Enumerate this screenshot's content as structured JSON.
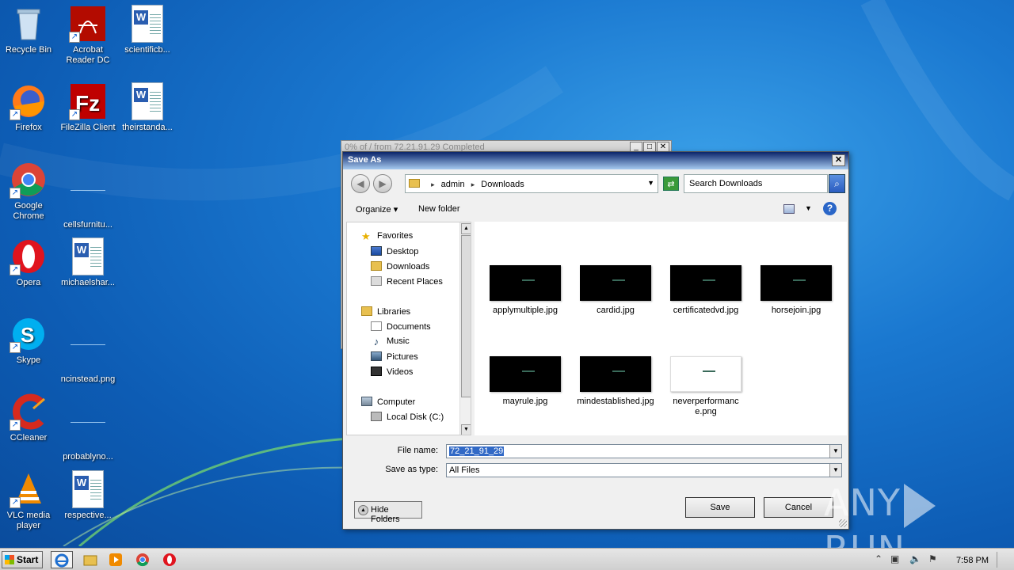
{
  "desktop": {
    "icons": [
      {
        "label": "Recycle Bin",
        "icon": "recycle-bin-icon"
      },
      {
        "label": "Acrobat Reader DC",
        "icon": "acrobat-icon"
      },
      {
        "label": "scientificb...",
        "icon": "word-doc-icon"
      },
      {
        "label": "Firefox",
        "icon": "firefox-icon"
      },
      {
        "label": "FileZilla Client",
        "icon": "filezilla-icon"
      },
      {
        "label": "theirstanda...",
        "icon": "word-doc-icon"
      },
      {
        "label": "Google Chrome",
        "icon": "chrome-icon"
      },
      {
        "label": "cellsfurnitu...",
        "icon": "file-icon"
      },
      {
        "label": "Opera",
        "icon": "opera-icon"
      },
      {
        "label": "michaelshar...",
        "icon": "word-doc-icon"
      },
      {
        "label": "Skype",
        "icon": "skype-icon"
      },
      {
        "label": "ncinstead.png",
        "icon": "file-icon"
      },
      {
        "label": "CCleaner",
        "icon": "ccleaner-icon"
      },
      {
        "label": "probablyno...",
        "icon": "file-icon"
      },
      {
        "label": "VLC media player",
        "icon": "vlc-icon"
      },
      {
        "label": "respective...",
        "icon": "word-doc-icon"
      }
    ]
  },
  "bg_window": {
    "title": "0% of / from 72.21.91.29 Completed"
  },
  "dialog": {
    "title": "Save As",
    "close": "✕",
    "address": {
      "root": "admin",
      "folder": "Downloads"
    },
    "search_placeholder": "Search Downloads",
    "toolbar": {
      "organize": "Organize ▾",
      "new_folder": "New folder",
      "help": "?"
    },
    "nav": {
      "favorites": "Favorites",
      "desktop": "Desktop",
      "downloads": "Downloads",
      "recent": "Recent Places",
      "libraries": "Libraries",
      "documents": "Documents",
      "music": "Music",
      "pictures": "Pictures",
      "videos": "Videos",
      "computer": "Computer",
      "local_disk": "Local Disk (C:)"
    },
    "files": [
      {
        "name": "applymultiple.jpg",
        "thumb": "black"
      },
      {
        "name": "cardid.jpg",
        "thumb": "black"
      },
      {
        "name": "certificatedvd.jpg",
        "thumb": "black"
      },
      {
        "name": "horsejoin.jpg",
        "thumb": "black"
      },
      {
        "name": "mayrule.jpg",
        "thumb": "black"
      },
      {
        "name": "mindestablished.jpg",
        "thumb": "black"
      },
      {
        "name": "neverperformance.png",
        "thumb": "white"
      }
    ],
    "file_name_label": "File name:",
    "file_name_value": "72_21_91_29",
    "save_type_label": "Save as type:",
    "save_type_value": "All Files",
    "hide_folders": "Hide Folders",
    "save": "Save",
    "cancel": "Cancel"
  },
  "taskbar": {
    "start": "Start",
    "clock": "7:58 PM"
  },
  "watermark": {
    "left": "ANY",
    "right": "RUN"
  }
}
